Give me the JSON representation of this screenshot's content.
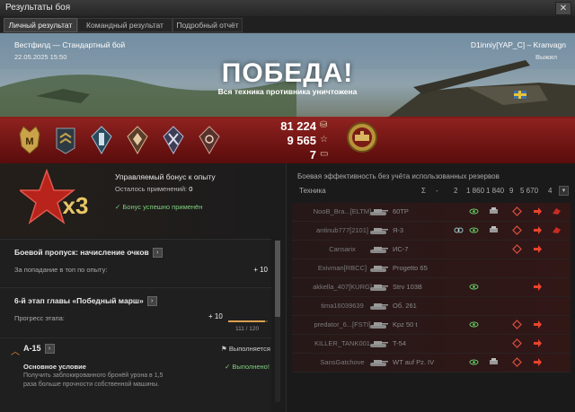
{
  "window": {
    "title": "Результаты боя"
  },
  "tabs": [
    {
      "label": "Личный результат",
      "active": true
    },
    {
      "label": "Командный результат",
      "active": false
    },
    {
      "label": "Подробный отчёт",
      "active": false
    }
  ],
  "battle": {
    "map_mode": "Вестфилд — Стандартный бой",
    "datetime": "22.05.2025 15:50",
    "player_line": "D1inniy[YAP_C] – Kranvagn",
    "status": "Выжил",
    "result": "ПОБЕДА!",
    "result_sub": "Вся техника противника уничтожена",
    "mastery_letter": "M"
  },
  "rewards": {
    "credits": "81 224",
    "xp": "9 565",
    "bonds": "7"
  },
  "bonus": {
    "title": "Управляемый бонус к опыту",
    "remaining_label": "Осталось применений: ",
    "remaining_value": "0",
    "applied": "Бонус успешно применён",
    "multiplier": "x3"
  },
  "battlepass": {
    "title": "Боевой пропуск: начисление очков",
    "desc": "За попадание в топ по опыту:",
    "value": "+ 10"
  },
  "stage": {
    "title": "6-й этап главы «Победный марш»",
    "desc": "Прогресс этапа:",
    "value": "+ 10",
    "progress_text": "111 / 120",
    "progress": 0.925
  },
  "mission": {
    "name": "A-15",
    "status": "Выполняется",
    "cond_title": "Основное условие",
    "cond_status": "Выполнено!",
    "cond_desc_1": "Получить заблокированного бронёй урона в 1,5",
    "cond_desc_2": "раза больше прочности собственной машины."
  },
  "team": {
    "header": "Боевая эффективность без учёта использованных резервов",
    "col_vehicle": "Техника",
    "col_heads": [
      "Σ",
      "-",
      "2",
      "1 860",
      "1 840",
      "9",
      "5 670",
      "4"
    ],
    "rows": [
      {
        "player": "NooB_Bra...[ELTM]",
        "vehicle": "60TP"
      },
      {
        "player": "antinub777[2101]",
        "vehicle": "Я-3"
      },
      {
        "player": "Cansarix",
        "vehicle": "ИС-7"
      },
      {
        "player": "Exivman[RBCC]",
        "vehicle": "Progetto 65"
      },
      {
        "player": "akkella_407[KURG]",
        "vehicle": "Strv 103B"
      },
      {
        "player": "tima16039639",
        "vehicle": "Об. 261"
      },
      {
        "player": "predator_6...[FSTI]",
        "vehicle": "Kpz 50 t"
      },
      {
        "player": "KILLER_TANK001",
        "vehicle": "T-54"
      },
      {
        "player": "SansGatchove",
        "vehicle": "WT auf Pz. IV"
      }
    ]
  },
  "colors": {
    "victory_band": "#8a1414",
    "accent_green": "#7fd07f",
    "gold": "#c9a24a"
  }
}
